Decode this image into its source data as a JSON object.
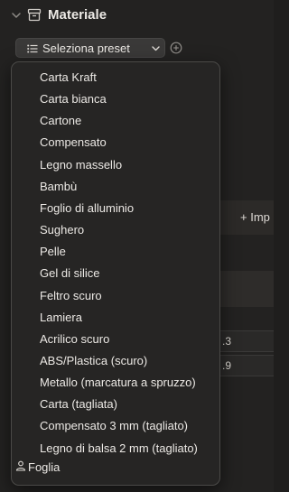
{
  "section": {
    "title": "Materiale"
  },
  "preset": {
    "button_label": "Seleziona preset"
  },
  "background": {
    "import_label": "+ Imp",
    "values": [
      ".3",
      ".9"
    ]
  },
  "menu": {
    "items": [
      "Carta Kraft",
      "Carta bianca",
      "Cartone",
      "Compensato",
      "Legno massello",
      "Bambù",
      "Foglio di alluminio",
      "Sughero",
      "Pelle",
      "Gel di silice",
      "Feltro scuro",
      "Lamiera",
      "Acrilico scuro",
      "ABS/Plastica (scuro)",
      "Metallo (marcatura a spruzzo)",
      "Carta (tagliata)",
      "Compensato 3 mm (tagliato)",
      "Legno di balsa 2 mm (tagliato)"
    ],
    "user_item": "Foglia"
  }
}
